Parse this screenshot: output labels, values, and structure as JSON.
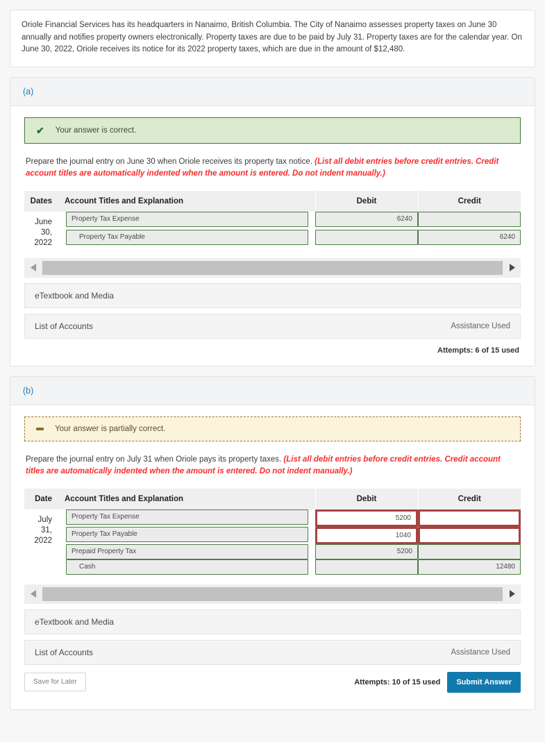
{
  "problem": {
    "text": "Oriole Financial Services has its headquarters in Nanaimo, British Columbia. The City of Nanaimo assesses property taxes on June 30 annually and notifies property owners electronically. Property taxes are due to be paid by July 31. Property taxes are for the calendar year. On June 30, 2022, Oriole receives its notice for its 2022 property taxes, which are due in the amount of $12,480."
  },
  "parts": [
    {
      "label": "(a)",
      "banner": {
        "status": "correct",
        "text": "Your answer is correct.",
        "icon": "check-icon"
      },
      "prompt_main": "Prepare the journal entry on June 30 when Oriole receives its property tax notice.",
      "prompt_hint": "(List all debit entries before credit entries. Credit account titles are automatically indented when the amount is entered. Do not indent manually.)",
      "columns": {
        "date": "Dates",
        "account": "Account Titles and Explanation",
        "debit": "Debit",
        "credit": "Credit"
      },
      "date_lines": [
        "June",
        "30,",
        "2022"
      ],
      "rows": [
        {
          "account": "Property Tax Expense",
          "account_indent": false,
          "account_state": "ok",
          "debit": "6240",
          "debit_state": "ok",
          "credit": "",
          "credit_state": "ok"
        },
        {
          "account": "Property Tax Payable",
          "account_indent": true,
          "account_state": "ok",
          "debit": "",
          "debit_state": "ok",
          "credit": "6240",
          "credit_state": "ok"
        }
      ],
      "etextbook_label": "eTextbook and Media",
      "accounts_label": "List of Accounts",
      "assistance_label": "Assistance Used",
      "attempts": "Attempts: 6 of 15 used"
    },
    {
      "label": "(b)",
      "banner": {
        "status": "partial",
        "text": "Your answer is partially correct.",
        "icon": "minus-icon"
      },
      "prompt_main": "Prepare the journal entry on July 31 when Oriole pays its property taxes.",
      "prompt_hint": "(List all debit entries before credit entries. Credit account titles are automatically indented when the amount is entered. Do not indent manually.)",
      "columns": {
        "date": "Date",
        "account": "Account Titles and Explanation",
        "debit": "Debit",
        "credit": "Credit"
      },
      "date_lines": [
        "July",
        "31,",
        "2022"
      ],
      "rows": [
        {
          "account": "Property Tax Expense",
          "account_indent": false,
          "account_state": "ok",
          "debit": "5200",
          "debit_state": "wrong",
          "credit": "",
          "credit_state": "wrong"
        },
        {
          "account": "Property Tax Payable",
          "account_indent": false,
          "account_state": "ok",
          "debit": "1040",
          "debit_state": "wrong",
          "credit": "",
          "credit_state": "wrong"
        },
        {
          "account": "Prepaid Property Tax",
          "account_indent": false,
          "account_state": "ok",
          "debit": "5200",
          "debit_state": "ok",
          "credit": "",
          "credit_state": "ok"
        },
        {
          "account": "Cash",
          "account_indent": true,
          "account_state": "ok",
          "debit": "",
          "debit_state": "ok",
          "credit": "12480",
          "credit_state": "ok"
        }
      ],
      "etextbook_label": "eTextbook and Media",
      "accounts_label": "List of Accounts",
      "assistance_label": "Assistance Used",
      "attempts": "Attempts: 10 of 15 used",
      "save_label": "Save for Later",
      "submit_label": "Submit Answer"
    }
  ],
  "colors": {
    "correct_border": "#3f7a36",
    "correct_bg": "#dcead0",
    "partial_border": "#9a7a32",
    "partial_bg": "#fcf3dd",
    "field_ok_border": "#4b7f42",
    "field_wrong_border": "#a64440",
    "hint_red": "#fa2c2c",
    "part_label_blue": "#1a7fb5",
    "submit_blue": "#1279ad"
  }
}
